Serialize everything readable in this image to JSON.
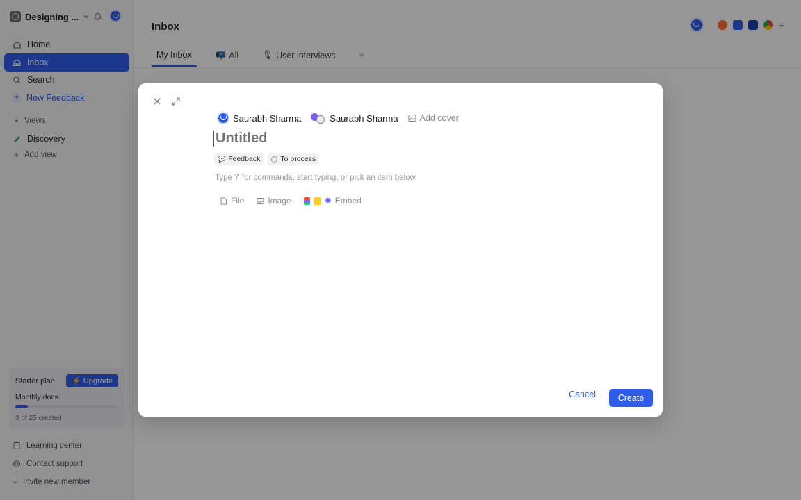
{
  "workspace": {
    "name": "Designing ..."
  },
  "sidebar": {
    "items": [
      {
        "label": "Home"
      },
      {
        "label": "Inbox"
      },
      {
        "label": "Search"
      },
      {
        "label": "New Feedback"
      }
    ],
    "views_label": "Views",
    "discovery_label": "Discovery",
    "add_view_label": "Add view"
  },
  "plan": {
    "name": "Starter plan",
    "upgrade_label": "Upgrade",
    "docs_label": "Monthly docs",
    "usage_text": "3 of 25 created",
    "usage_fraction": 0.12
  },
  "footer": {
    "learning": "Learning center",
    "contact": "Contact support",
    "invite": "Invite new member"
  },
  "main": {
    "title": "Inbox",
    "tabs": [
      {
        "label": "My Inbox"
      },
      {
        "label": "All"
      },
      {
        "label": "User interviews"
      }
    ]
  },
  "modal": {
    "author": "Saurabh Sharma",
    "assignee": "Saurabh Sharma",
    "add_cover": "Add cover",
    "title_placeholder": "Untitled",
    "chips": [
      "Feedback",
      "To process"
    ],
    "hint": "Type '/' for commands, start typing, or pick an item below",
    "inserts": {
      "file": "File",
      "image": "Image",
      "embed": "Embed"
    },
    "cancel": "Cancel",
    "create": "Create"
  },
  "colors": {
    "accent": "#2f5ce8"
  }
}
